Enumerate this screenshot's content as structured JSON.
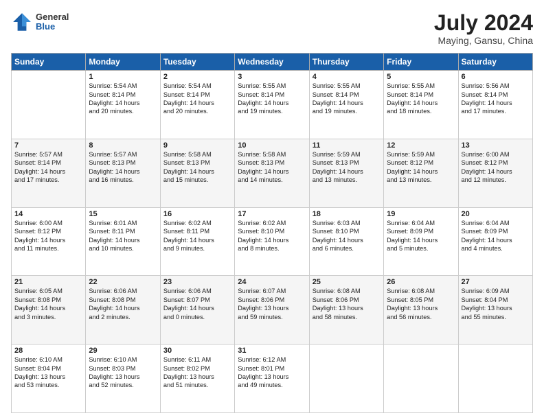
{
  "logo": {
    "line1": "General",
    "line2": "Blue"
  },
  "title": "July 2024",
  "subtitle": "Maying, Gansu, China",
  "headers": [
    "Sunday",
    "Monday",
    "Tuesday",
    "Wednesday",
    "Thursday",
    "Friday",
    "Saturday"
  ],
  "weeks": [
    [
      {
        "day": "",
        "content": ""
      },
      {
        "day": "1",
        "content": "Sunrise: 5:54 AM\nSunset: 8:14 PM\nDaylight: 14 hours\nand 20 minutes."
      },
      {
        "day": "2",
        "content": "Sunrise: 5:54 AM\nSunset: 8:14 PM\nDaylight: 14 hours\nand 20 minutes."
      },
      {
        "day": "3",
        "content": "Sunrise: 5:55 AM\nSunset: 8:14 PM\nDaylight: 14 hours\nand 19 minutes."
      },
      {
        "day": "4",
        "content": "Sunrise: 5:55 AM\nSunset: 8:14 PM\nDaylight: 14 hours\nand 19 minutes."
      },
      {
        "day": "5",
        "content": "Sunrise: 5:55 AM\nSunset: 8:14 PM\nDaylight: 14 hours\nand 18 minutes."
      },
      {
        "day": "6",
        "content": "Sunrise: 5:56 AM\nSunset: 8:14 PM\nDaylight: 14 hours\nand 17 minutes."
      }
    ],
    [
      {
        "day": "7",
        "content": "Sunrise: 5:57 AM\nSunset: 8:14 PM\nDaylight: 14 hours\nand 17 minutes."
      },
      {
        "day": "8",
        "content": "Sunrise: 5:57 AM\nSunset: 8:13 PM\nDaylight: 14 hours\nand 16 minutes."
      },
      {
        "day": "9",
        "content": "Sunrise: 5:58 AM\nSunset: 8:13 PM\nDaylight: 14 hours\nand 15 minutes."
      },
      {
        "day": "10",
        "content": "Sunrise: 5:58 AM\nSunset: 8:13 PM\nDaylight: 14 hours\nand 14 minutes."
      },
      {
        "day": "11",
        "content": "Sunrise: 5:59 AM\nSunset: 8:13 PM\nDaylight: 14 hours\nand 13 minutes."
      },
      {
        "day": "12",
        "content": "Sunrise: 5:59 AM\nSunset: 8:12 PM\nDaylight: 14 hours\nand 13 minutes."
      },
      {
        "day": "13",
        "content": "Sunrise: 6:00 AM\nSunset: 8:12 PM\nDaylight: 14 hours\nand 12 minutes."
      }
    ],
    [
      {
        "day": "14",
        "content": "Sunrise: 6:00 AM\nSunset: 8:12 PM\nDaylight: 14 hours\nand 11 minutes."
      },
      {
        "day": "15",
        "content": "Sunrise: 6:01 AM\nSunset: 8:11 PM\nDaylight: 14 hours\nand 10 minutes."
      },
      {
        "day": "16",
        "content": "Sunrise: 6:02 AM\nSunset: 8:11 PM\nDaylight: 14 hours\nand 9 minutes."
      },
      {
        "day": "17",
        "content": "Sunrise: 6:02 AM\nSunset: 8:10 PM\nDaylight: 14 hours\nand 8 minutes."
      },
      {
        "day": "18",
        "content": "Sunrise: 6:03 AM\nSunset: 8:10 PM\nDaylight: 14 hours\nand 6 minutes."
      },
      {
        "day": "19",
        "content": "Sunrise: 6:04 AM\nSunset: 8:09 PM\nDaylight: 14 hours\nand 5 minutes."
      },
      {
        "day": "20",
        "content": "Sunrise: 6:04 AM\nSunset: 8:09 PM\nDaylight: 14 hours\nand 4 minutes."
      }
    ],
    [
      {
        "day": "21",
        "content": "Sunrise: 6:05 AM\nSunset: 8:08 PM\nDaylight: 14 hours\nand 3 minutes."
      },
      {
        "day": "22",
        "content": "Sunrise: 6:06 AM\nSunset: 8:08 PM\nDaylight: 14 hours\nand 2 minutes."
      },
      {
        "day": "23",
        "content": "Sunrise: 6:06 AM\nSunset: 8:07 PM\nDaylight: 14 hours\nand 0 minutes."
      },
      {
        "day": "24",
        "content": "Sunrise: 6:07 AM\nSunset: 8:06 PM\nDaylight: 13 hours\nand 59 minutes."
      },
      {
        "day": "25",
        "content": "Sunrise: 6:08 AM\nSunset: 8:06 PM\nDaylight: 13 hours\nand 58 minutes."
      },
      {
        "day": "26",
        "content": "Sunrise: 6:08 AM\nSunset: 8:05 PM\nDaylight: 13 hours\nand 56 minutes."
      },
      {
        "day": "27",
        "content": "Sunrise: 6:09 AM\nSunset: 8:04 PM\nDaylight: 13 hours\nand 55 minutes."
      }
    ],
    [
      {
        "day": "28",
        "content": "Sunrise: 6:10 AM\nSunset: 8:04 PM\nDaylight: 13 hours\nand 53 minutes."
      },
      {
        "day": "29",
        "content": "Sunrise: 6:10 AM\nSunset: 8:03 PM\nDaylight: 13 hours\nand 52 minutes."
      },
      {
        "day": "30",
        "content": "Sunrise: 6:11 AM\nSunset: 8:02 PM\nDaylight: 13 hours\nand 51 minutes."
      },
      {
        "day": "31",
        "content": "Sunrise: 6:12 AM\nSunset: 8:01 PM\nDaylight: 13 hours\nand 49 minutes."
      },
      {
        "day": "",
        "content": ""
      },
      {
        "day": "",
        "content": ""
      },
      {
        "day": "",
        "content": ""
      }
    ]
  ]
}
